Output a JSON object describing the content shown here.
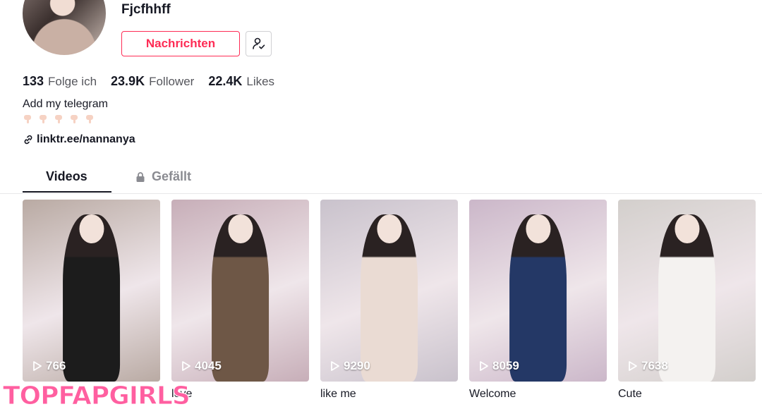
{
  "profile": {
    "username": "Fjcfhhff",
    "message_button": "Nachrichten"
  },
  "stats": [
    {
      "value": "133",
      "label": "Folge ich"
    },
    {
      "value": "23.9K",
      "label": "Follower"
    },
    {
      "value": "22.4K",
      "label": "Likes"
    }
  ],
  "bio": {
    "text": "Add my telegram",
    "emoji_icon": "pointing-down-hand-icon",
    "emoji_count": 5,
    "link": "linktr.ee/nannanya"
  },
  "tabs": {
    "videos": "Videos",
    "liked": "Gefällt"
  },
  "videos": [
    {
      "plays": "766",
      "caption": "",
      "bg": "#b9aaa3",
      "outfit": "#1c1c1c"
    },
    {
      "plays": "4045",
      "caption": "love",
      "bg": "#c7aeb8",
      "outfit": "#6e5746"
    },
    {
      "plays": "9290",
      "caption": "like me",
      "bg": "#c9c2cc",
      "outfit": "#eadbd3"
    },
    {
      "plays": "8059",
      "caption": "Welcome",
      "bg": "#cbb7c9",
      "outfit": "#243866"
    },
    {
      "plays": "7638",
      "caption": "Cute",
      "bg": "#d3cfcc",
      "outfit": "#f4f2f0"
    }
  ],
  "watermark": "TOPFAPGIRLS",
  "colors": {
    "accent": "#fe2c55",
    "text": "#161823",
    "muted": "#8a8b91"
  }
}
